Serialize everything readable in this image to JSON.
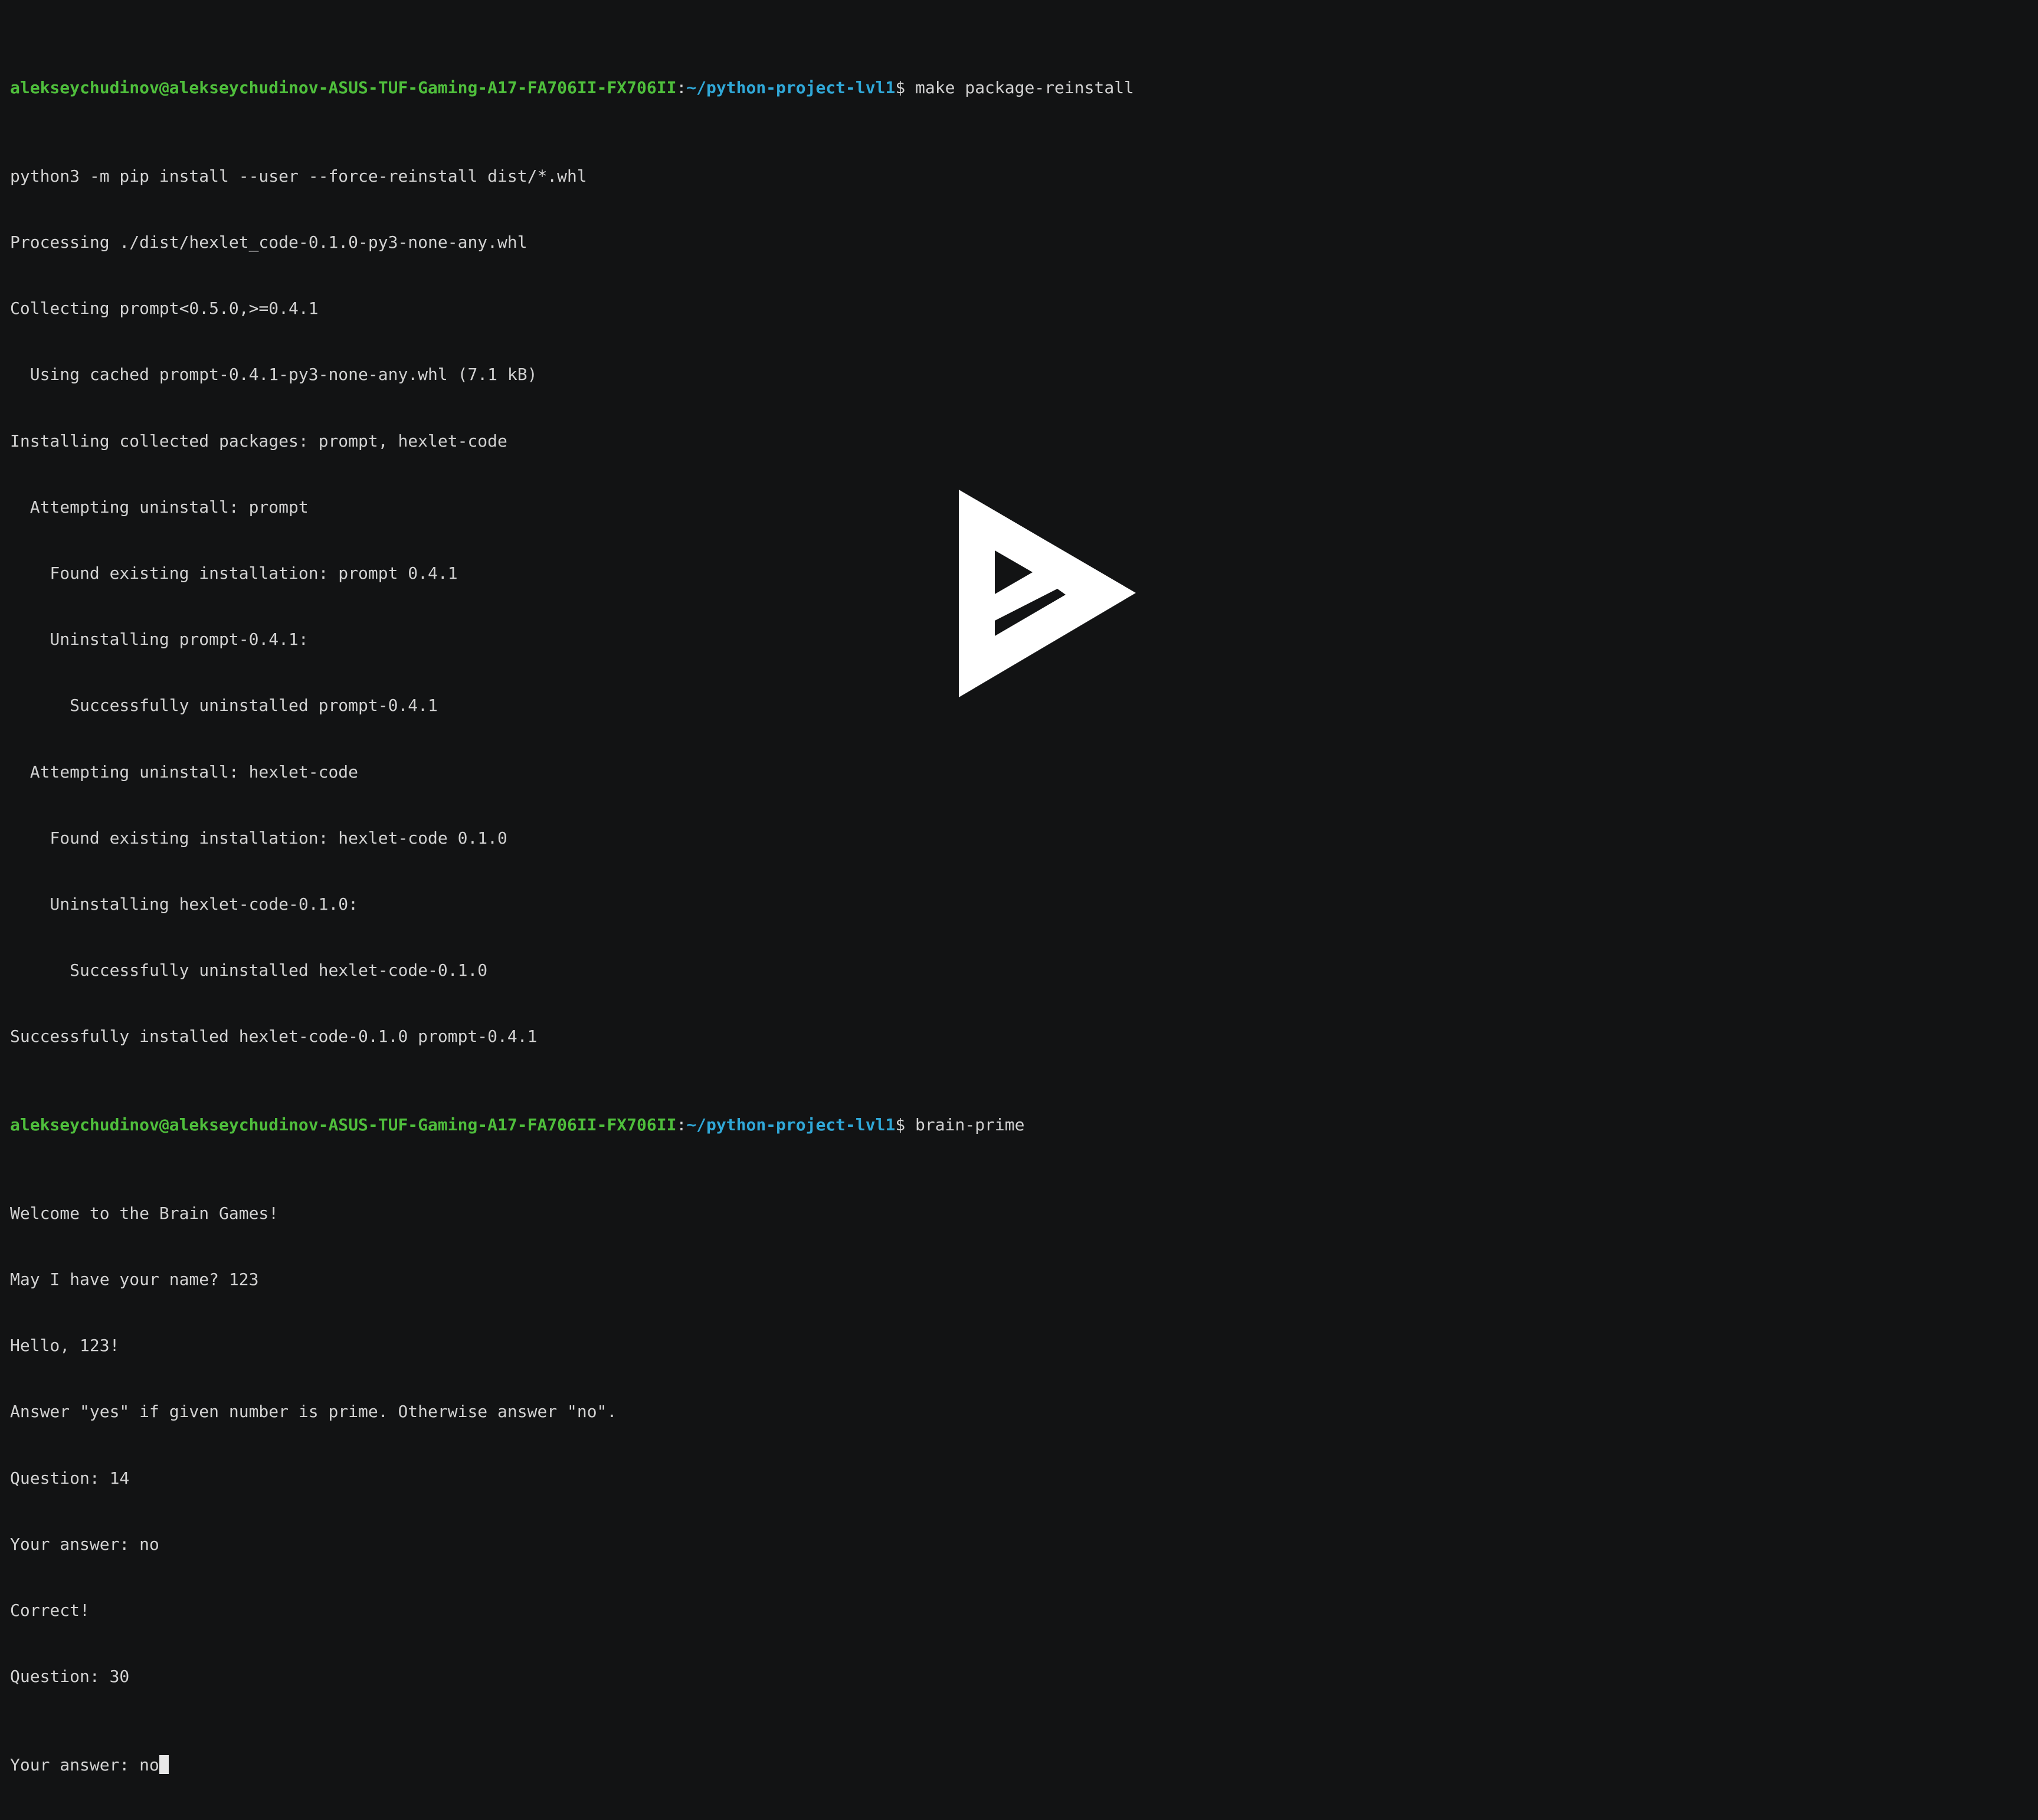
{
  "prompt": {
    "user_host": "alekseychudinov@alekseychudinov-ASUS-TUF-Gaming-A17-FA706II-FX706II",
    "colon": ":",
    "path": "~/python-project-lvl1",
    "dollar": "$ "
  },
  "commands": {
    "first": "make package-reinstall",
    "second": "brain-prime"
  },
  "output_block_1": [
    "python3 -m pip install --user --force-reinstall dist/*.whl",
    "Processing ./dist/hexlet_code-0.1.0-py3-none-any.whl",
    "Collecting prompt<0.5.0,>=0.4.1",
    "  Using cached prompt-0.4.1-py3-none-any.whl (7.1 kB)",
    "Installing collected packages: prompt, hexlet-code",
    "  Attempting uninstall: prompt",
    "    Found existing installation: prompt 0.4.1",
    "    Uninstalling prompt-0.4.1:",
    "      Successfully uninstalled prompt-0.4.1",
    "  Attempting uninstall: hexlet-code",
    "    Found existing installation: hexlet-code 0.1.0",
    "    Uninstalling hexlet-code-0.1.0:",
    "      Successfully uninstalled hexlet-code-0.1.0",
    "Successfully installed hexlet-code-0.1.0 prompt-0.4.1"
  ],
  "output_block_2": [
    "Welcome to the Brain Games!",
    "May I have your name? 123",
    "Hello, 123!",
    "Answer \"yes\" if given number is prime. Otherwise answer \"no\".",
    "Question: 14",
    "Your answer: no",
    "Correct!",
    "Question: 30"
  ],
  "current_input": "Your answer: no",
  "overlay": {
    "icon": "asciinema-play-icon"
  },
  "colors": {
    "background": "#121314",
    "text": "#d2d2d2",
    "user_host": "#4fbf3c",
    "path": "#30a8d8",
    "play_icon": "#ffffff"
  }
}
